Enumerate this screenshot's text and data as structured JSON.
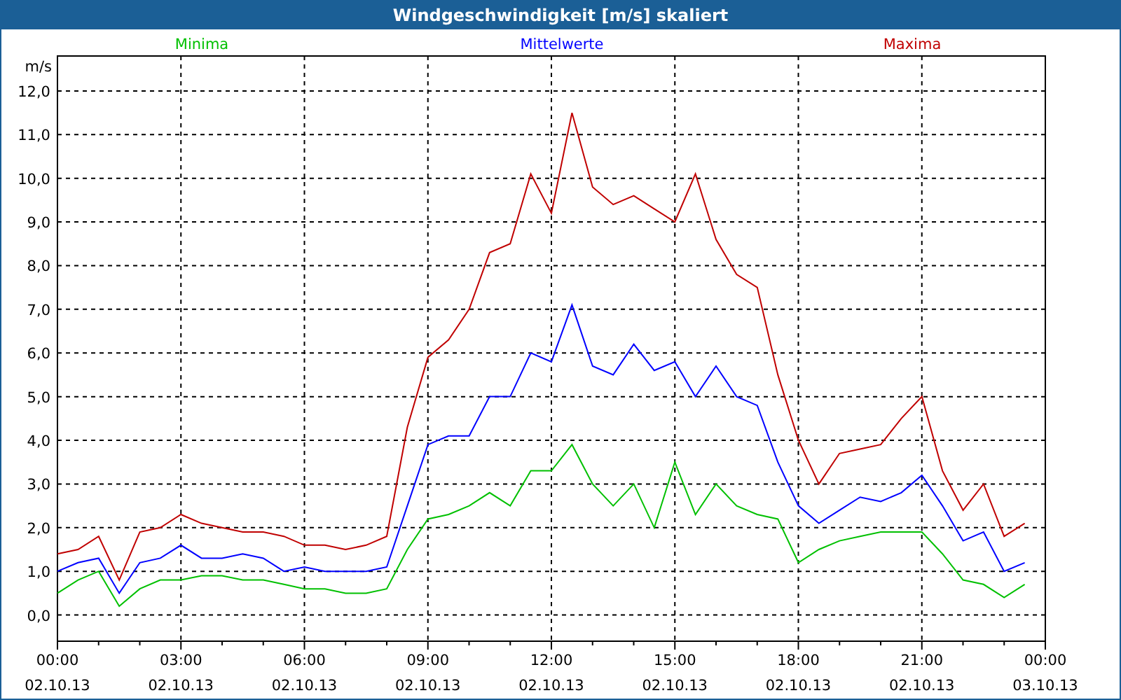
{
  "window": {
    "title": "Windgeschwindigkeit [m/s] skaliert"
  },
  "chart": {
    "chart_data": {
      "type": "line",
      "ylabel": "m/s",
      "categories": [
        "00:00\n02.10.13",
        null,
        null,
        null,
        null,
        null,
        "03:00\n02.10.13",
        null,
        null,
        null,
        null,
        null,
        "06:00\n02.10.13",
        null,
        null,
        null,
        null,
        null,
        "09:00\n02.10.13",
        null,
        null,
        null,
        null,
        null,
        "12:00\n02.10.13",
        null,
        null,
        null,
        null,
        null,
        "15:00\n02.10.13",
        null,
        null,
        null,
        null,
        null,
        "18:00\n02.10.13",
        null,
        null,
        null,
        null,
        null,
        "21:00\n02.10.13",
        null,
        null,
        null,
        null,
        null,
        "00:00\n03.10.13"
      ],
      "series": [
        {
          "name": "Minima",
          "color": "#00c000",
          "values": [
            0.5,
            0.8,
            1.0,
            0.2,
            0.6,
            0.8,
            0.8,
            0.9,
            0.9,
            0.8,
            0.8,
            0.7,
            0.6,
            0.6,
            0.5,
            0.5,
            0.6,
            1.5,
            2.2,
            2.3,
            2.5,
            2.8,
            2.5,
            3.3,
            3.3,
            3.9,
            3.0,
            2.5,
            3.0,
            2.0,
            3.5,
            2.3,
            3.0,
            2.5,
            2.3,
            2.2,
            1.2,
            1.5,
            1.7,
            1.8,
            1.9,
            1.9,
            1.9,
            1.4,
            0.8,
            0.7,
            0.4,
            0.7,
            null
          ]
        },
        {
          "name": "Mittelwerte",
          "color": "#0000ff",
          "values": [
            1.0,
            1.2,
            1.3,
            0.5,
            1.2,
            1.3,
            1.6,
            1.3,
            1.3,
            1.4,
            1.3,
            1.0,
            1.1,
            1.0,
            1.0,
            1.0,
            1.1,
            2.5,
            3.9,
            4.1,
            4.1,
            5.0,
            5.0,
            6.0,
            5.8,
            7.1,
            5.7,
            5.5,
            6.2,
            5.6,
            5.8,
            5.0,
            5.7,
            5.0,
            4.8,
            3.5,
            2.5,
            2.1,
            2.4,
            2.7,
            2.6,
            2.8,
            3.2,
            2.5,
            1.7,
            1.9,
            1.0,
            1.2,
            null
          ]
        },
        {
          "name": "Maxima",
          "color": "#c00000",
          "values": [
            1.4,
            1.5,
            1.8,
            0.8,
            1.9,
            2.0,
            2.3,
            2.1,
            2.0,
            1.9,
            1.9,
            1.8,
            1.6,
            1.6,
            1.5,
            1.6,
            1.8,
            4.3,
            5.9,
            6.3,
            7.0,
            8.3,
            8.5,
            10.1,
            9.2,
            11.5,
            9.8,
            9.4,
            9.6,
            9.3,
            9.0,
            10.1,
            8.6,
            7.8,
            7.5,
            5.5,
            4.0,
            3.0,
            3.7,
            3.8,
            3.9,
            4.5,
            5.0,
            3.3,
            2.4,
            3.0,
            1.8,
            2.1,
            null
          ]
        }
      ],
      "ylim": [
        -0.6,
        12.8
      ],
      "grid": true,
      "yticks": [
        {
          "value": 0,
          "label": "0,0"
        },
        {
          "value": 1,
          "label": "1,0"
        },
        {
          "value": 2,
          "label": "2,0"
        },
        {
          "value": 3,
          "label": "3,0"
        },
        {
          "value": 4,
          "label": "4,0"
        },
        {
          "value": 5,
          "label": "5,0"
        },
        {
          "value": 6,
          "label": "6,0"
        },
        {
          "value": 7,
          "label": "7,0"
        },
        {
          "value": 8,
          "label": "8,0"
        },
        {
          "value": 9,
          "label": "9,0"
        },
        {
          "value": 10,
          "label": "10,0"
        },
        {
          "value": 11,
          "label": "11,0"
        },
        {
          "value": 12,
          "label": "12,0"
        }
      ]
    }
  }
}
